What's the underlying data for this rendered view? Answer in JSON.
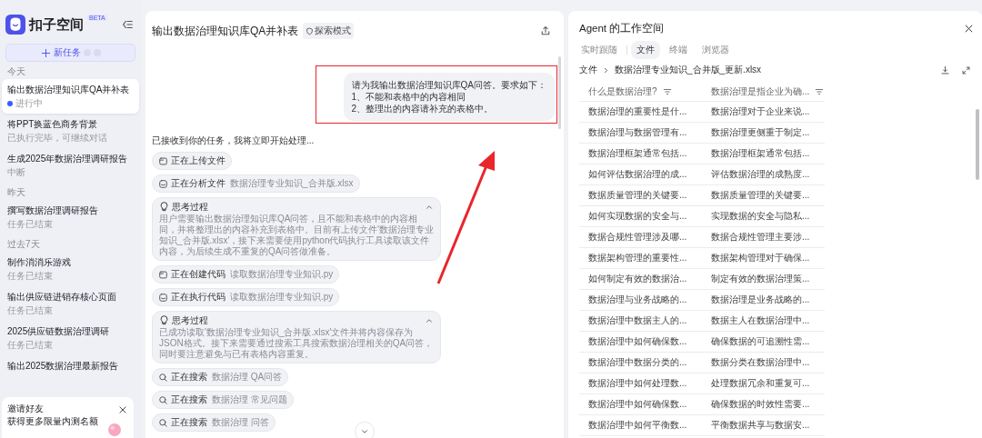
{
  "sidebar": {
    "brand": {
      "name": "扣子空间",
      "badge": "BETA"
    },
    "new_task": {
      "label": "新任务"
    },
    "groups": [
      {
        "label": "今天",
        "items": [
          {
            "title": "输出数据治理知识库QA并补表",
            "subtitle": "进行中",
            "selected": true,
            "in_progress": true
          },
          {
            "title": "将PPT换蓝色商务背景",
            "subtitle": "已执行完毕，可继续对话",
            "selected": false,
            "in_progress": false
          },
          {
            "title": "生成2025年数据治理调研报告",
            "subtitle": "中断",
            "selected": false,
            "in_progress": false
          }
        ]
      },
      {
        "label": "昨天",
        "items": [
          {
            "title": "撰写数据治理调研报告",
            "subtitle": "任务已结束",
            "selected": false,
            "in_progress": false
          }
        ]
      },
      {
        "label": "过去7天",
        "items": [
          {
            "title": "制作消消乐游戏",
            "subtitle": "任务已结束",
            "selected": false,
            "in_progress": false
          },
          {
            "title": "输出供应链进销存核心页面",
            "subtitle": "任务已结束",
            "selected": false,
            "in_progress": false
          },
          {
            "title": "2025供应链数据治理调研",
            "subtitle": "任务已结束",
            "selected": false,
            "in_progress": false
          },
          {
            "title": "输出2025数据治理最新报告",
            "selected": false,
            "in_progress": false
          }
        ]
      }
    ],
    "invite": {
      "title": "邀请好友",
      "text": "获得更多限量内测名额"
    }
  },
  "chat": {
    "title": "输出数据治理知识库QA并补表",
    "mode": "探索模式",
    "user_message": [
      "请为我输出数据治理知识库QA问答。要求如下：",
      "1、不能和表格中的内容相同",
      "2、整理出的内容请补充的表格中。"
    ],
    "reply": "已接收到你的任务，我将立即开始处理...",
    "steps": [
      {
        "kind": "file",
        "label": "正在上传文件"
      },
      {
        "kind": "analyze",
        "label": "正在分析文件",
        "detail": "数据治理专业知识_合并版.xlsx"
      },
      {
        "kind": "thinking",
        "label": "思考过程",
        "expanded": true,
        "text": "用户需要输出数据治理知识库QA问答，且不能和表格中的内容相同，并将整理出的内容补充到表格中。目前有上传文件'数据治理专业知识_合并版.xlsx'，接下来需要使用python代码执行工具读取该文件内容，为后续生成不重复的QA问答做准备。"
      },
      {
        "kind": "file",
        "label": "正在创建代码",
        "detail": "读取数据治理专业知识.py"
      },
      {
        "kind": "analyze",
        "label": "正在执行代码",
        "detail": "读取数据治理专业知识.py"
      },
      {
        "kind": "thinking",
        "label": "思考过程",
        "expanded": true,
        "text": "已成功读取'数据治理专业知识_合并版.xlsx'文件并将内容保存为JSON格式。接下来需要通过搜索工具搜索数据治理相关的QA问答，同时要注意避免与已有表格内容重复。"
      },
      {
        "kind": "search",
        "label": "正在搜索",
        "detail": "数据治理 QA问答"
      },
      {
        "kind": "search",
        "label": "正在搜索",
        "detail": "数据治理 常见问题"
      },
      {
        "kind": "search",
        "label": "正在搜索",
        "detail": "数据治理 问答"
      }
    ]
  },
  "workspace": {
    "title": "Agent 的工作空间",
    "tabs": [
      {
        "label": "实时跟随",
        "selected": false
      },
      {
        "label": "文件",
        "selected": true
      },
      {
        "label": "终端",
        "selected": false
      },
      {
        "label": "浏览器",
        "selected": false
      }
    ],
    "breadcrumb": [
      "文件",
      "数据治理专业知识_合并版_更新.xlsx"
    ],
    "table": {
      "columns": [
        "什么是数据治理?",
        "数据治理是指企业为确..."
      ],
      "rows": [
        [
          "数据治理的重要性是什...",
          "数据治理对于企业来说..."
        ],
        [
          "数据治理与数据管理有...",
          "数据治理更侧重于制定..."
        ],
        [
          "数据治理框架通常包括...",
          "数据治理框架通常包括..."
        ],
        [
          "如何评估数据治理的成...",
          "评估数据治理的成熟度..."
        ],
        [
          "数据质量管理的关键要...",
          "数据质量管理的关键要..."
        ],
        [
          "如何实现数据的安全与...",
          "实现数据的安全与隐私..."
        ],
        [
          "数据合规性管理涉及哪...",
          "数据合规性管理主要涉..."
        ],
        [
          "数据架构管理的重要性...",
          "数据架构管理对于确保..."
        ],
        [
          "如何制定有效的数据治...",
          "制定有效的数据治理策..."
        ],
        [
          "数据治理与业务战略的...",
          "数据治理是业务战略的..."
        ],
        [
          "数据治理中数据主人的...",
          "数据主人在数据治理中..."
        ],
        [
          "数据治理中如何确保数...",
          "确保数据的可追溯性需..."
        ],
        [
          "数据治理中数据分类的...",
          "数据分类在数据治理中..."
        ],
        [
          "数据治理中如何处理数...",
          "处理数据冗余和重复可..."
        ],
        [
          "数据治理中如何确保数...",
          "确保数据的时效性需要..."
        ],
        [
          "数据治理中如何平衡数...",
          "平衡数据共享与数据安..."
        ]
      ]
    }
  }
}
